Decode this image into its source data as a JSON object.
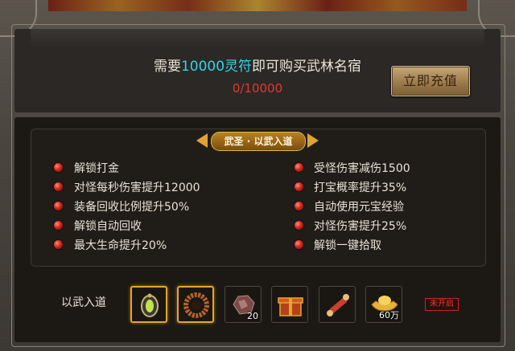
{
  "purchase": {
    "prefix": "需要",
    "amount": "10000灵符",
    "suffix": "即可购买武林名宿",
    "progress": "0/10000",
    "buy_button": "立即充值"
  },
  "tier": {
    "banner": "武圣 · 以武入道",
    "perks_left": [
      "解锁打金",
      "对怪每秒伤害提升12000",
      "装备回收比例提升50%",
      "解锁自动回收",
      "最大生命提升20%"
    ],
    "perks_right": [
      "受怪伤害减伤1500",
      "打宝概率提升35%",
      "自动使用元宝经验",
      "对怪伤害提升25%",
      "解锁一键拾取"
    ]
  },
  "rewards": {
    "label": "以武入道",
    "items": [
      {
        "icon": "amulet-icon",
        "count": ""
      },
      {
        "icon": "bead-ring-icon",
        "count": ""
      },
      {
        "icon": "ore-icon",
        "count": "20"
      },
      {
        "icon": "gift-box-icon",
        "count": ""
      },
      {
        "icon": "scroll-icon",
        "count": ""
      },
      {
        "icon": "gold-ingot-icon",
        "count": "60万"
      }
    ],
    "status": "未开启"
  },
  "colors": {
    "accent_cyan": "#31d6e6",
    "progress_red": "#e23a2e",
    "highlight_gold": "#e6a52b"
  }
}
